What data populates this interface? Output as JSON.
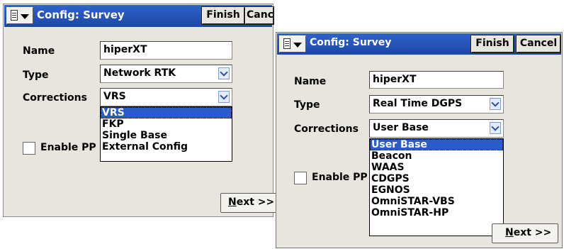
{
  "left_window": {
    "title": "Config: Survey",
    "finish_label": "Finish",
    "cancel_label": "Cancel",
    "name_label": "Name",
    "name_value": "hiperXT",
    "type_label": "Type",
    "type_value": "Network RTK",
    "corrections_label": "Corrections",
    "corrections_value": "VRS",
    "corrections_options": [
      "VRS",
      "FKP",
      "Single Base",
      "External Config"
    ],
    "corrections_selected_index": 0,
    "enable_label": "Enable PP",
    "enable_checked": false,
    "next_mnemonic": "N",
    "next_rest": "ext >>"
  },
  "right_window": {
    "title": "Config: Survey",
    "finish_label": "Finish",
    "cancel_label": "Cancel",
    "name_label": "Name",
    "name_value": "hiperXT",
    "type_label": "Type",
    "type_value": "Real Time DGPS",
    "corrections_label": "Corrections",
    "corrections_value": "User Base",
    "corrections_options": [
      "User Base",
      "Beacon",
      "WAAS",
      "CDGPS",
      "EGNOS",
      "OmniSTAR-VBS",
      "OmniSTAR-HP"
    ],
    "corrections_selected_index": 0,
    "enable_label": "Enable PP",
    "enable_checked": false,
    "next_mnemonic": "N",
    "next_rest": "ext >>"
  },
  "colors": {
    "titlebar": "#2f63cc",
    "selection": "#2a5bc8",
    "window_bg": "#e7e5de"
  }
}
